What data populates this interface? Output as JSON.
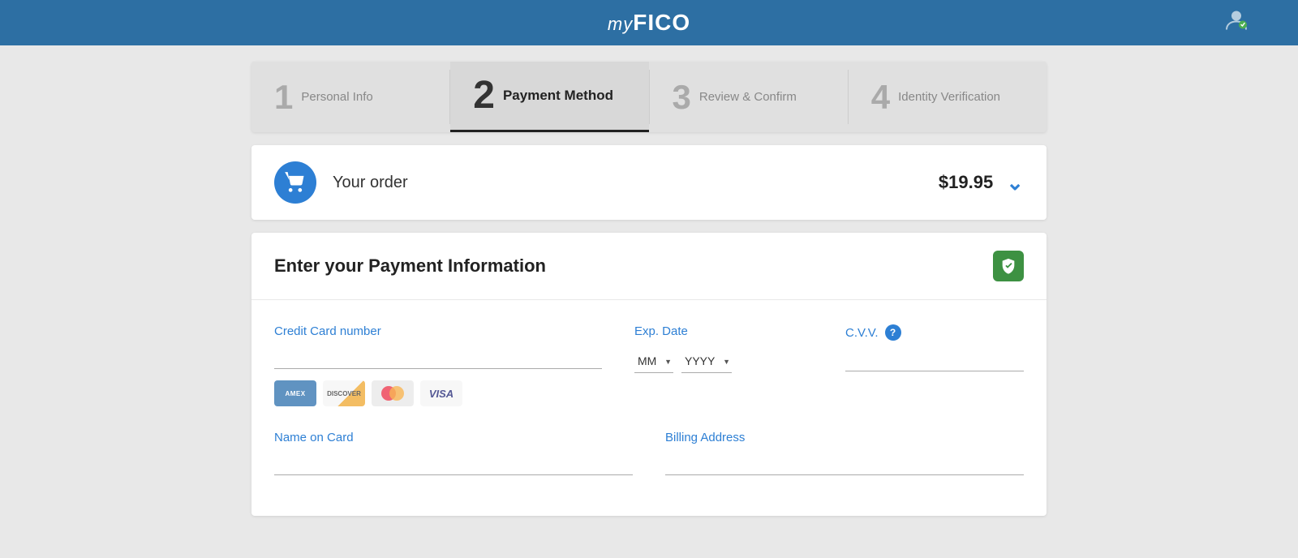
{
  "header": {
    "logo_my": "my",
    "logo_fico": "FICO",
    "user_icon": "👤"
  },
  "steps": [
    {
      "id": "step-1",
      "number": "1",
      "label": "Personal Info",
      "active": false
    },
    {
      "id": "step-2",
      "number": "2",
      "label": "Payment Method",
      "active": true
    },
    {
      "id": "step-3",
      "number": "3",
      "label": "Review & Confirm",
      "active": false
    },
    {
      "id": "step-4",
      "number": "4",
      "label": "Identity Verification",
      "active": false
    }
  ],
  "order": {
    "label": "Your order",
    "price": "$19.95"
  },
  "payment": {
    "title": "Enter your Payment Information",
    "credit_card_label": "Credit Card number",
    "credit_card_placeholder": "",
    "exp_date_label": "Exp. Date",
    "exp_month_default": "MM",
    "exp_year_default": "YYYY",
    "cvv_label": "C.V.V.",
    "cvv_placeholder": "",
    "name_on_card_label": "Name on Card",
    "billing_address_label": "Billing Address",
    "card_brands": [
      "AMEX",
      "DISCOVER",
      "MC",
      "VISA"
    ]
  }
}
